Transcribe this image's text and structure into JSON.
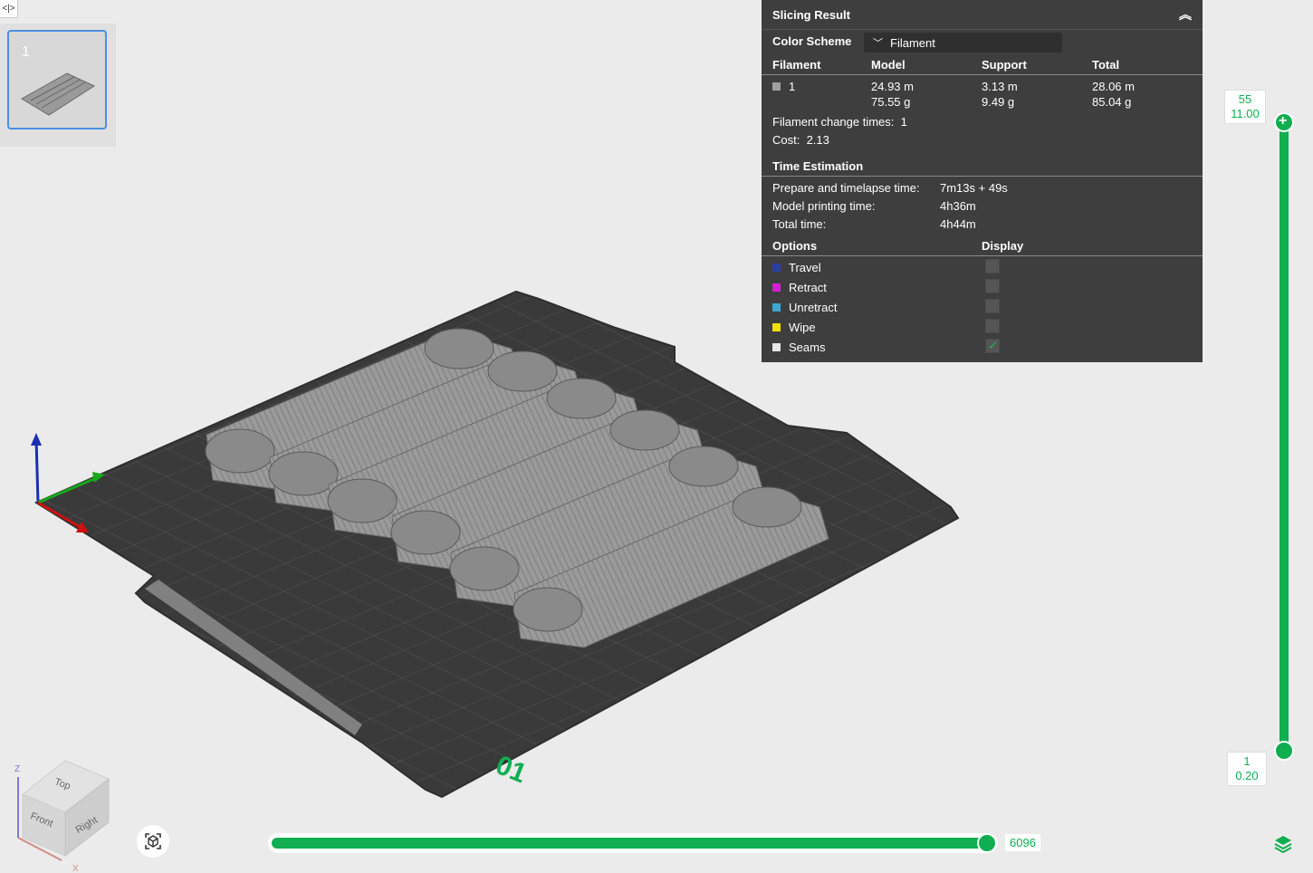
{
  "toolbar": {
    "toggle_label": "<|>"
  },
  "thumbnails": [
    {
      "label": "1"
    }
  ],
  "plate": {
    "label": "01"
  },
  "slicing": {
    "title": "Slicing Result",
    "color_scheme_label": "Color Scheme",
    "color_scheme_value": "Filament",
    "columns": [
      "Filament",
      "Model",
      "Support",
      "Total"
    ],
    "filament_row": {
      "id": "1",
      "model_len": "24.93 m",
      "model_wt": "75.55 g",
      "support_len": "3.13 m",
      "support_wt": "9.49 g",
      "total_len": "28.06 m",
      "total_wt": "85.04 g",
      "swatch_color": "#a0a0a0"
    },
    "change_times_label": "Filament change times:",
    "change_times_value": "1",
    "cost_label": "Cost:",
    "cost_value": "2.13",
    "time_title": "Time Estimation",
    "prepare_label": "Prepare and timelapse time:",
    "prepare_value": "7m13s + 49s",
    "model_time_label": "Model printing time:",
    "model_time_value": "4h36m",
    "total_time_label": "Total time:",
    "total_time_value": "4h44m",
    "options_label": "Options",
    "display_label": "Display",
    "options": [
      {
        "label": "Travel",
        "color": "#2a3ea8",
        "checked": false
      },
      {
        "label": "Retract",
        "color": "#d21fd2",
        "checked": false
      },
      {
        "label": "Unretract",
        "color": "#3aa8d4",
        "checked": false
      },
      {
        "label": "Wipe",
        "color": "#f0e000",
        "checked": false
      },
      {
        "label": "Seams",
        "color": "#e6e6e6",
        "checked": true
      }
    ]
  },
  "layer_slider": {
    "top_layer": "55",
    "top_height": "11.00",
    "bottom_layer": "1",
    "bottom_height": "0.20",
    "accent": "#0fae50"
  },
  "move_slider": {
    "value": "6096"
  },
  "nav_cube": {
    "top": "Top",
    "front": "Front",
    "right": "Right",
    "z": "Z",
    "x": "X"
  }
}
